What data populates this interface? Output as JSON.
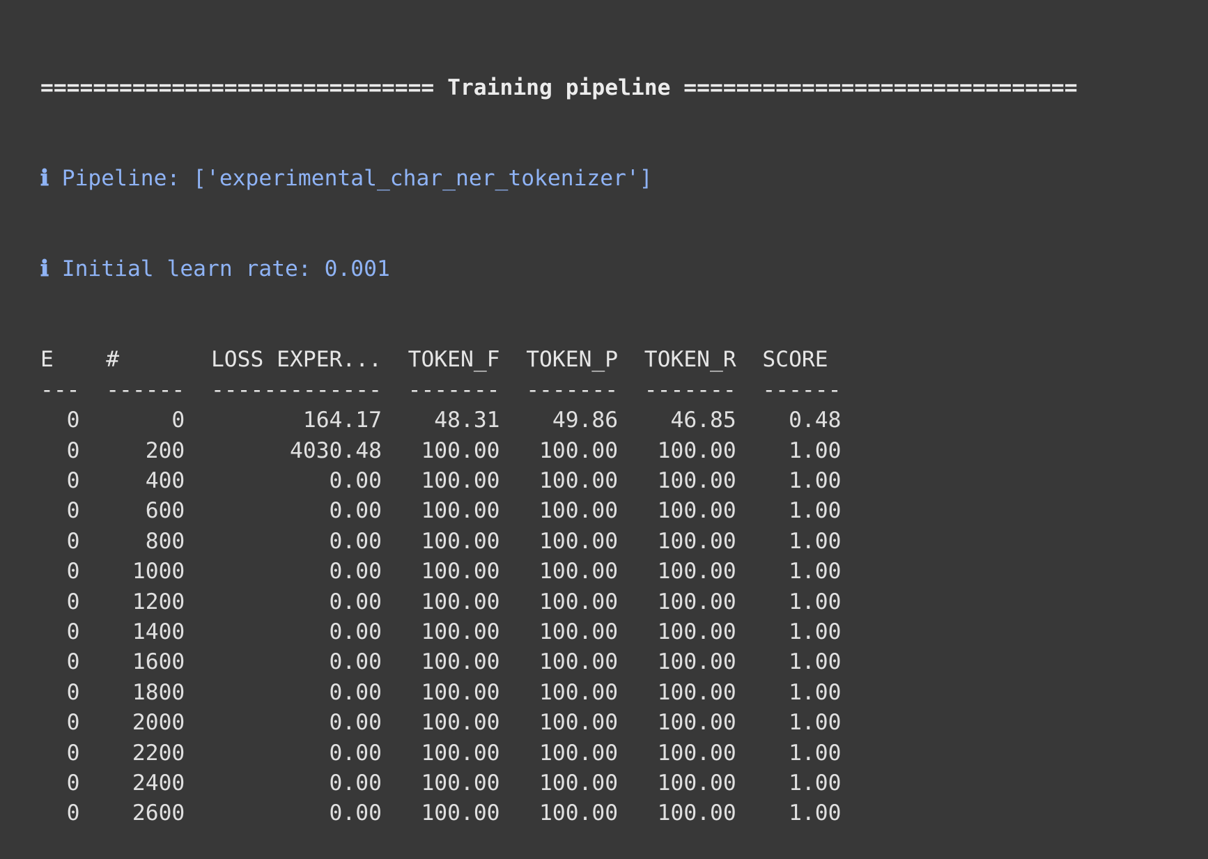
{
  "title_rule_left": "==============================",
  "title": "Training pipeline",
  "title_rule_right": "==============================",
  "info_icon": "ℹ",
  "info": [
    "Pipeline: ['experimental_char_ner_tokenizer']",
    "Initial learn rate: 0.001"
  ],
  "table": {
    "columns": [
      "E",
      "#",
      "LOSS EXPER...",
      "TOKEN_F",
      "TOKEN_P",
      "TOKEN_R",
      "SCORE"
    ],
    "widths": [
      3,
      6,
      13,
      7,
      7,
      7,
      6
    ],
    "align": [
      "right",
      "right",
      "right",
      "right",
      "right",
      "right",
      "right"
    ],
    "rows": [
      [
        "0",
        "0",
        "164.17",
        "48.31",
        "49.86",
        "46.85",
        "0.48"
      ],
      [
        "0",
        "200",
        "4030.48",
        "100.00",
        "100.00",
        "100.00",
        "1.00"
      ],
      [
        "0",
        "400",
        "0.00",
        "100.00",
        "100.00",
        "100.00",
        "1.00"
      ],
      [
        "0",
        "600",
        "0.00",
        "100.00",
        "100.00",
        "100.00",
        "1.00"
      ],
      [
        "0",
        "800",
        "0.00",
        "100.00",
        "100.00",
        "100.00",
        "1.00"
      ],
      [
        "0",
        "1000",
        "0.00",
        "100.00",
        "100.00",
        "100.00",
        "1.00"
      ],
      [
        "0",
        "1200",
        "0.00",
        "100.00",
        "100.00",
        "100.00",
        "1.00"
      ],
      [
        "0",
        "1400",
        "0.00",
        "100.00",
        "100.00",
        "100.00",
        "1.00"
      ],
      [
        "0",
        "1600",
        "0.00",
        "100.00",
        "100.00",
        "100.00",
        "1.00"
      ],
      [
        "0",
        "1800",
        "0.00",
        "100.00",
        "100.00",
        "100.00",
        "1.00"
      ],
      [
        "0",
        "2000",
        "0.00",
        "100.00",
        "100.00",
        "100.00",
        "1.00"
      ],
      [
        "0",
        "2200",
        "0.00",
        "100.00",
        "100.00",
        "100.00",
        "1.00"
      ],
      [
        "0",
        "2400",
        "0.00",
        "100.00",
        "100.00",
        "100.00",
        "1.00"
      ],
      [
        "0",
        "2600",
        "0.00",
        "100.00",
        "100.00",
        "100.00",
        "1.00"
      ]
    ]
  },
  "colors": {
    "background": "#383838",
    "text": "#e0e0e0",
    "info": "#8fb3f5"
  }
}
